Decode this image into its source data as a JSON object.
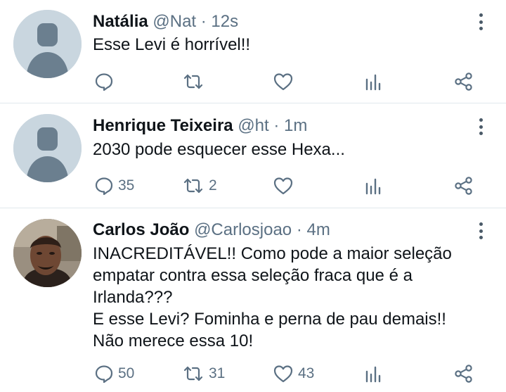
{
  "tweets": [
    {
      "name": "Natália",
      "handle": "@Nat",
      "time": "12s",
      "text": [
        "Esse Levi é horrível!!"
      ],
      "replies": "",
      "retweets": "",
      "likes": "",
      "avatar": "default-avatar"
    },
    {
      "name": "Henrique Teixeira",
      "handle": "@ht",
      "time": "1m",
      "text": [
        "2030 pode esquecer esse Hexa..."
      ],
      "replies": "35",
      "retweets": "2",
      "likes": "",
      "avatar": "default-avatar"
    },
    {
      "name": "Carlos João",
      "handle": "@Carlosjoao",
      "time": "4m",
      "text": [
        "INACREDITÁVEL!! Como pode a maior seleção",
        "empatar contra essa seleção fraca que é a",
        "Irlanda???",
        "E esse Levi? Fominha e perna de pau demais!!",
        "Não merece essa 10!"
      ],
      "replies": "50",
      "retweets": "31",
      "likes": "43",
      "avatar": "photo-avatar"
    }
  ],
  "separator": " · ",
  "icons": [
    "reply-icon",
    "retweet-icon",
    "like-icon",
    "analytics-icon",
    "share-icon",
    "more-icon"
  ],
  "colors": {
    "text": "#0f1419",
    "meta": "#5b7083",
    "icon": "#5b7083",
    "divider": "#e1e8ed",
    "avatar_bg": "#c9d6df",
    "avatar_fg": "#6b7f8f"
  }
}
